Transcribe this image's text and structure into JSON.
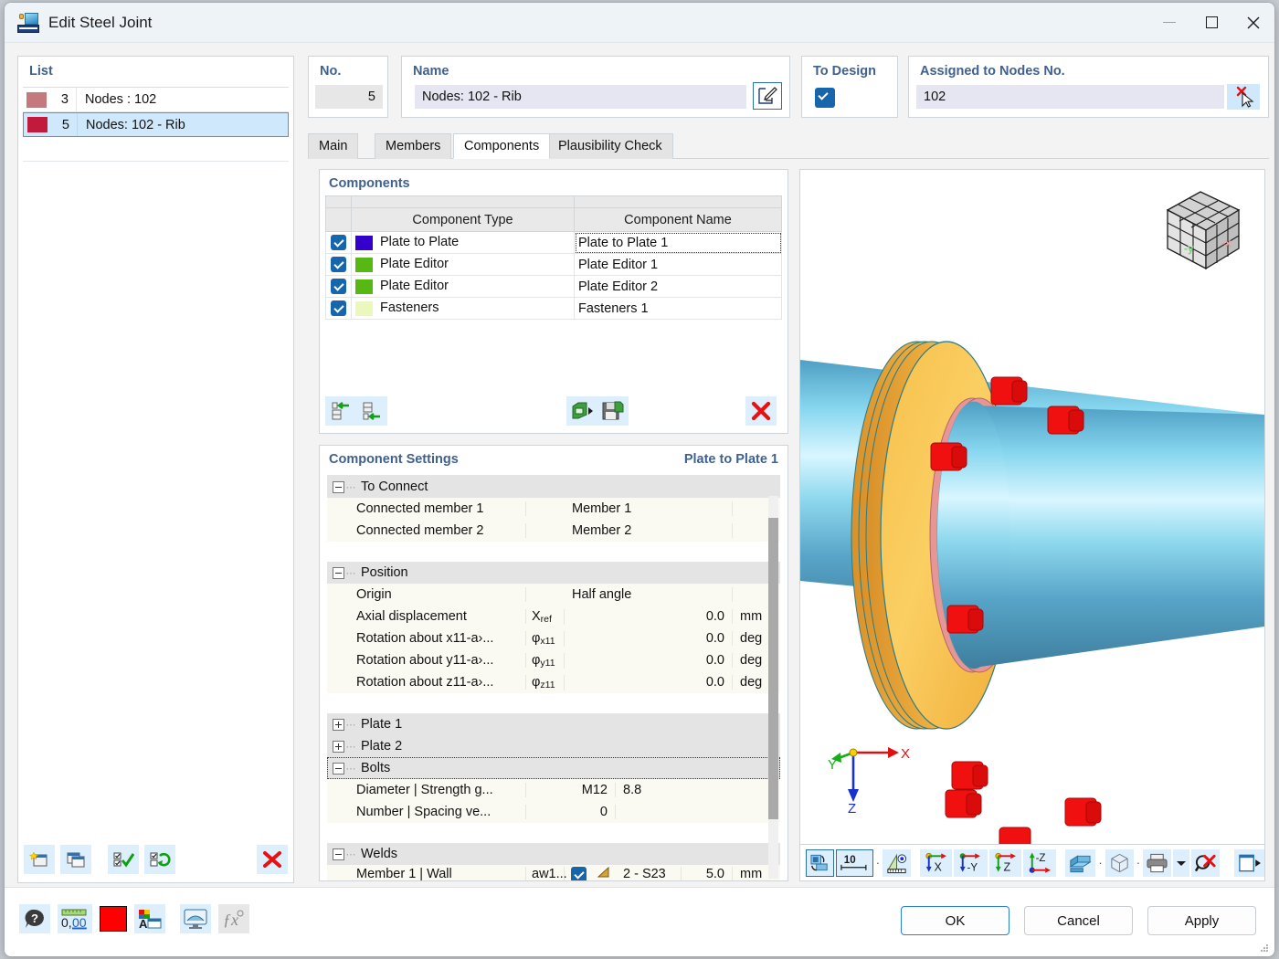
{
  "window": {
    "title": "Edit Steel Joint",
    "app_icon": "steel-joint-icon",
    "minimize": "–",
    "maximize": "□",
    "close": "✕"
  },
  "list_panel": {
    "label": "List",
    "rows": [
      {
        "num": "3",
        "text": "Nodes : 102",
        "color": "#c4797e",
        "selected": false
      },
      {
        "num": "5",
        "text": "Nodes: 102 - Rib",
        "color": "#c11a3c",
        "selected": true
      }
    ],
    "toolbar": [
      {
        "name": "new-joint-button"
      },
      {
        "name": "copy-joint-button"
      },
      {
        "name": "select-all-button"
      },
      {
        "name": "invert-selection-button"
      },
      {
        "name": "delete-joint-button"
      }
    ]
  },
  "no_field": {
    "label": "No.",
    "value": "5"
  },
  "name_field": {
    "label": "Name",
    "value": "Nodes: 102 - Rib",
    "edit_button": "name-edit-icon"
  },
  "to_design": {
    "label": "To Design",
    "checked": true
  },
  "assigned_nodes": {
    "label": "Assigned to Nodes No.",
    "value": "102",
    "pick_button": "pick-nodes-icon"
  },
  "tabs": [
    {
      "label": "Main",
      "active": false
    },
    {
      "label": "Members",
      "active": false
    },
    {
      "label": "Components",
      "active": true
    },
    {
      "label": "Plausibility Check",
      "active": false
    }
  ],
  "components": {
    "title": "Components",
    "columns": [
      "",
      "Component Type",
      "Component Name"
    ],
    "rows": [
      {
        "checked": true,
        "color": "#3300cc",
        "type": "Plate to Plate",
        "name": "Plate to Plate 1",
        "selected": true
      },
      {
        "checked": true,
        "color": "#57b814",
        "type": "Plate Editor",
        "name": "Plate Editor 1",
        "selected": false
      },
      {
        "checked": true,
        "color": "#57b814",
        "type": "Plate Editor",
        "name": "Plate Editor 2",
        "selected": false
      },
      {
        "checked": true,
        "color": "#eaf7bd",
        "type": "Fasteners",
        "name": "Fasteners 1",
        "selected": false
      }
    ],
    "toolbar": [
      {
        "name": "move-component-up-button"
      },
      {
        "name": "move-component-down-button"
      },
      {
        "name": "import-component-button"
      },
      {
        "name": "save-component-button"
      },
      {
        "name": "delete-component-button"
      }
    ]
  },
  "component_settings": {
    "title": "Component Settings",
    "subject": "Plate to Plate 1",
    "tree": [
      {
        "kind": "category",
        "expanded": true,
        "label": "To Connect"
      },
      {
        "kind": "item",
        "name": "Connected member 1",
        "symbol": "",
        "value": "Member 1",
        "unit": ""
      },
      {
        "kind": "item",
        "name": "Connected member 2",
        "symbol": "",
        "value": "Member 2",
        "unit": ""
      },
      {
        "kind": "blank"
      },
      {
        "kind": "category",
        "expanded": true,
        "label": "Position"
      },
      {
        "kind": "item",
        "name": "Origin",
        "symbol": "",
        "value": "Half angle",
        "unit": ""
      },
      {
        "kind": "item",
        "name": "Axial displacement",
        "symbol": "Xref",
        "value": "0.0",
        "unit": "mm",
        "right": true
      },
      {
        "kind": "item",
        "name": "Rotation about x11-a›...",
        "symbol": "φx11",
        "value": "0.0",
        "unit": "deg",
        "right": true
      },
      {
        "kind": "item",
        "name": "Rotation about y11-a›...",
        "symbol": "φy11",
        "value": "0.0",
        "unit": "deg",
        "right": true
      },
      {
        "kind": "item",
        "name": "Rotation about z11-a›...",
        "symbol": "φz11",
        "value": "0.0",
        "unit": "deg",
        "right": true
      },
      {
        "kind": "blank"
      },
      {
        "kind": "category",
        "expanded": false,
        "label": "Plate 1"
      },
      {
        "kind": "category",
        "expanded": false,
        "label": "Plate 2"
      },
      {
        "kind": "category",
        "expanded": true,
        "label": "Bolts",
        "selected": true
      },
      {
        "kind": "item",
        "name": "Diameter | Strength g...",
        "symbol": "",
        "value": "M12",
        "unit": "8.8",
        "right": true
      },
      {
        "kind": "item",
        "name": "Number | Spacing ve...",
        "symbol": "",
        "value": "0",
        "unit": "",
        "right": true
      },
      {
        "kind": "blank"
      },
      {
        "kind": "category",
        "expanded": true,
        "label": "Welds"
      },
      {
        "kind": "weld",
        "name": "Member 1 | Wall",
        "symbol": "aw1...",
        "checked": true,
        "value": "2 - S23",
        "number": "5.0",
        "unit": "mm"
      }
    ]
  },
  "viewport": {
    "nav_cube": "navigation-cube",
    "nav_cube_faces": {
      "left": "-y",
      "right": "-x"
    },
    "axes": {
      "x": "X",
      "y": "Y",
      "z": "Z"
    },
    "toolbar": [
      {
        "name": "render-mode-button",
        "label": ""
      },
      {
        "name": "scale-value-button",
        "label": "10"
      },
      {
        "name": "measure-button",
        "label": ""
      },
      {
        "name": "view-x-button",
        "label": "X"
      },
      {
        "name": "view-negative-y-button",
        "label": "-Y"
      },
      {
        "name": "view-z-button",
        "label": "Z"
      },
      {
        "name": "view-negative-z-button",
        "label": "-Z"
      },
      {
        "name": "solid-model-button",
        "label": ""
      },
      {
        "name": "wireframe-button",
        "label": ""
      },
      {
        "name": "print-button",
        "label": ""
      },
      {
        "name": "print-dropdown-button",
        "label": "▾"
      },
      {
        "name": "clear-selection-button",
        "label": ""
      },
      {
        "name": "detach-view-button",
        "label": ""
      }
    ]
  },
  "bottom_toolbar": [
    {
      "name": "help-button"
    },
    {
      "name": "number-format-button",
      "label": "0,00"
    },
    {
      "name": "color-swatch-button",
      "color": "#ff0000"
    },
    {
      "name": "display-properties-button"
    },
    {
      "name": "visualization-button"
    },
    {
      "name": "formula-button",
      "label": "ƒx"
    }
  ],
  "dialog_buttons": {
    "ok": "OK",
    "cancel": "Cancel",
    "apply": "Apply"
  }
}
